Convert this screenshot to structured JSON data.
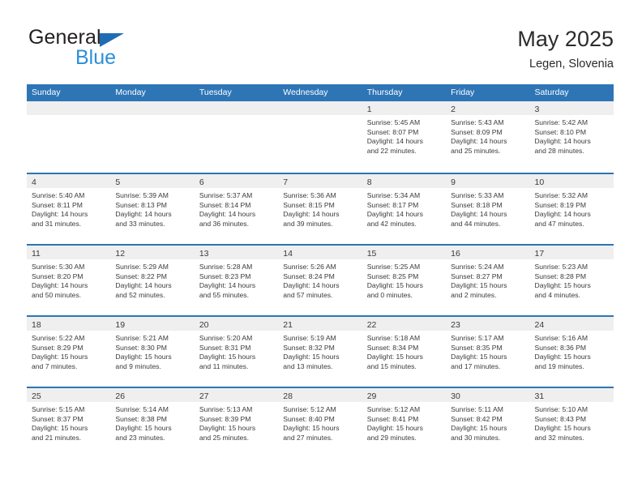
{
  "brand": {
    "name_dark": "General",
    "name_blue": "Blue",
    "triangle_icon": "triangle-icon",
    "accent_color": "#1f6cb4",
    "blue_text_color": "#2b8fd8"
  },
  "header": {
    "title": "May 2025",
    "subtitle": "Legen, Slovenia"
  },
  "theme": {
    "header_blue": "#2e75b6",
    "day_band_gray": "#efefef",
    "text_color": "#3a3a3a"
  },
  "weekdays": [
    "Sunday",
    "Monday",
    "Tuesday",
    "Wednesday",
    "Thursday",
    "Friday",
    "Saturday"
  ],
  "weeks": [
    [
      {
        "day": "",
        "lines": []
      },
      {
        "day": "",
        "lines": []
      },
      {
        "day": "",
        "lines": []
      },
      {
        "day": "",
        "lines": []
      },
      {
        "day": "1",
        "lines": [
          "Sunrise: 5:45 AM",
          "Sunset: 8:07 PM",
          "Daylight: 14 hours",
          "and 22 minutes."
        ]
      },
      {
        "day": "2",
        "lines": [
          "Sunrise: 5:43 AM",
          "Sunset: 8:09 PM",
          "Daylight: 14 hours",
          "and 25 minutes."
        ]
      },
      {
        "day": "3",
        "lines": [
          "Sunrise: 5:42 AM",
          "Sunset: 8:10 PM",
          "Daylight: 14 hours",
          "and 28 minutes."
        ]
      }
    ],
    [
      {
        "day": "4",
        "lines": [
          "Sunrise: 5:40 AM",
          "Sunset: 8:11 PM",
          "Daylight: 14 hours",
          "and 31 minutes."
        ]
      },
      {
        "day": "5",
        "lines": [
          "Sunrise: 5:39 AM",
          "Sunset: 8:13 PM",
          "Daylight: 14 hours",
          "and 33 minutes."
        ]
      },
      {
        "day": "6",
        "lines": [
          "Sunrise: 5:37 AM",
          "Sunset: 8:14 PM",
          "Daylight: 14 hours",
          "and 36 minutes."
        ]
      },
      {
        "day": "7",
        "lines": [
          "Sunrise: 5:36 AM",
          "Sunset: 8:15 PM",
          "Daylight: 14 hours",
          "and 39 minutes."
        ]
      },
      {
        "day": "8",
        "lines": [
          "Sunrise: 5:34 AM",
          "Sunset: 8:17 PM",
          "Daylight: 14 hours",
          "and 42 minutes."
        ]
      },
      {
        "day": "9",
        "lines": [
          "Sunrise: 5:33 AM",
          "Sunset: 8:18 PM",
          "Daylight: 14 hours",
          "and 44 minutes."
        ]
      },
      {
        "day": "10",
        "lines": [
          "Sunrise: 5:32 AM",
          "Sunset: 8:19 PM",
          "Daylight: 14 hours",
          "and 47 minutes."
        ]
      }
    ],
    [
      {
        "day": "11",
        "lines": [
          "Sunrise: 5:30 AM",
          "Sunset: 8:20 PM",
          "Daylight: 14 hours",
          "and 50 minutes."
        ]
      },
      {
        "day": "12",
        "lines": [
          "Sunrise: 5:29 AM",
          "Sunset: 8:22 PM",
          "Daylight: 14 hours",
          "and 52 minutes."
        ]
      },
      {
        "day": "13",
        "lines": [
          "Sunrise: 5:28 AM",
          "Sunset: 8:23 PM",
          "Daylight: 14 hours",
          "and 55 minutes."
        ]
      },
      {
        "day": "14",
        "lines": [
          "Sunrise: 5:26 AM",
          "Sunset: 8:24 PM",
          "Daylight: 14 hours",
          "and 57 minutes."
        ]
      },
      {
        "day": "15",
        "lines": [
          "Sunrise: 5:25 AM",
          "Sunset: 8:25 PM",
          "Daylight: 15 hours",
          "and 0 minutes."
        ]
      },
      {
        "day": "16",
        "lines": [
          "Sunrise: 5:24 AM",
          "Sunset: 8:27 PM",
          "Daylight: 15 hours",
          "and 2 minutes."
        ]
      },
      {
        "day": "17",
        "lines": [
          "Sunrise: 5:23 AM",
          "Sunset: 8:28 PM",
          "Daylight: 15 hours",
          "and 4 minutes."
        ]
      }
    ],
    [
      {
        "day": "18",
        "lines": [
          "Sunrise: 5:22 AM",
          "Sunset: 8:29 PM",
          "Daylight: 15 hours",
          "and 7 minutes."
        ]
      },
      {
        "day": "19",
        "lines": [
          "Sunrise: 5:21 AM",
          "Sunset: 8:30 PM",
          "Daylight: 15 hours",
          "and 9 minutes."
        ]
      },
      {
        "day": "20",
        "lines": [
          "Sunrise: 5:20 AM",
          "Sunset: 8:31 PM",
          "Daylight: 15 hours",
          "and 11 minutes."
        ]
      },
      {
        "day": "21",
        "lines": [
          "Sunrise: 5:19 AM",
          "Sunset: 8:32 PM",
          "Daylight: 15 hours",
          "and 13 minutes."
        ]
      },
      {
        "day": "22",
        "lines": [
          "Sunrise: 5:18 AM",
          "Sunset: 8:34 PM",
          "Daylight: 15 hours",
          "and 15 minutes."
        ]
      },
      {
        "day": "23",
        "lines": [
          "Sunrise: 5:17 AM",
          "Sunset: 8:35 PM",
          "Daylight: 15 hours",
          "and 17 minutes."
        ]
      },
      {
        "day": "24",
        "lines": [
          "Sunrise: 5:16 AM",
          "Sunset: 8:36 PM",
          "Daylight: 15 hours",
          "and 19 minutes."
        ]
      }
    ],
    [
      {
        "day": "25",
        "lines": [
          "Sunrise: 5:15 AM",
          "Sunset: 8:37 PM",
          "Daylight: 15 hours",
          "and 21 minutes."
        ]
      },
      {
        "day": "26",
        "lines": [
          "Sunrise: 5:14 AM",
          "Sunset: 8:38 PM",
          "Daylight: 15 hours",
          "and 23 minutes."
        ]
      },
      {
        "day": "27",
        "lines": [
          "Sunrise: 5:13 AM",
          "Sunset: 8:39 PM",
          "Daylight: 15 hours",
          "and 25 minutes."
        ]
      },
      {
        "day": "28",
        "lines": [
          "Sunrise: 5:12 AM",
          "Sunset: 8:40 PM",
          "Daylight: 15 hours",
          "and 27 minutes."
        ]
      },
      {
        "day": "29",
        "lines": [
          "Sunrise: 5:12 AM",
          "Sunset: 8:41 PM",
          "Daylight: 15 hours",
          "and 29 minutes."
        ]
      },
      {
        "day": "30",
        "lines": [
          "Sunrise: 5:11 AM",
          "Sunset: 8:42 PM",
          "Daylight: 15 hours",
          "and 30 minutes."
        ]
      },
      {
        "day": "31",
        "lines": [
          "Sunrise: 5:10 AM",
          "Sunset: 8:43 PM",
          "Daylight: 15 hours",
          "and 32 minutes."
        ]
      }
    ]
  ]
}
